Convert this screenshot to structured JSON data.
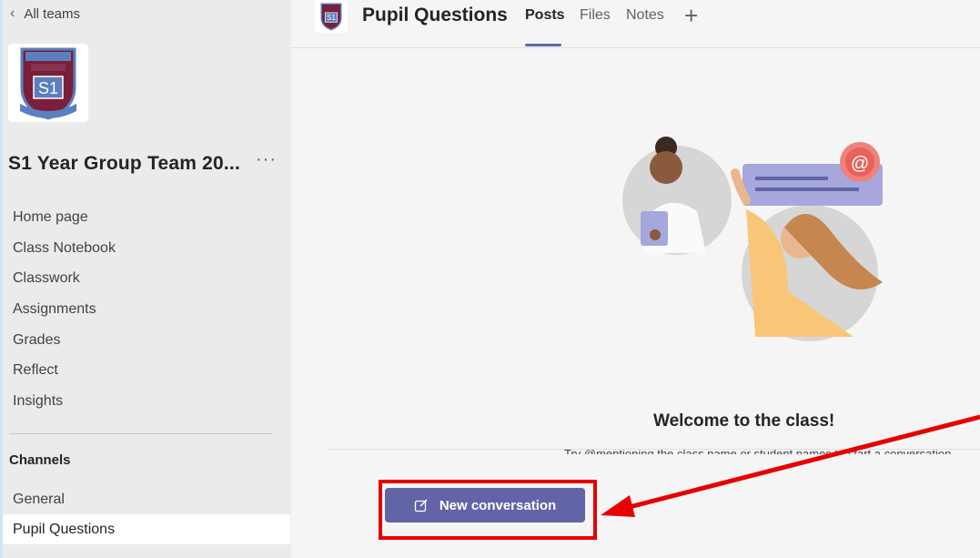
{
  "sidebar": {
    "back_label": "All teams",
    "team_name": "S1 Year Group Team 20...",
    "more_label": "···",
    "nav": [
      "Home page",
      "Class Notebook",
      "Classwork",
      "Assignments",
      "Grades",
      "Reflect",
      "Insights"
    ],
    "channels_heading": "Channels",
    "channels": [
      "General",
      "Pupil Questions"
    ],
    "active_channel": "Pupil Questions"
  },
  "header": {
    "channel_title": "Pupil Questions",
    "tabs": [
      "Posts",
      "Files",
      "Notes"
    ],
    "active_tab": "Posts",
    "add_tab": "+"
  },
  "logo_text": "S1",
  "main": {
    "welcome_title": "Welcome to the class!",
    "hint": "Try @mentioning the class name or student names to start a conversation.",
    "new_conversation_label": "New conversation"
  },
  "colors": {
    "accent": "#6264a7",
    "highlight": "#e60000"
  }
}
